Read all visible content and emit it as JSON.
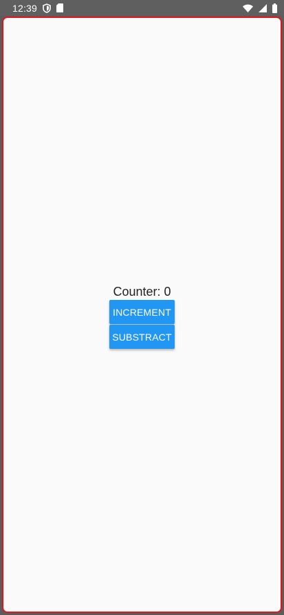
{
  "status_bar": {
    "time": "12:39",
    "left_icons": [
      "shield-icon",
      "sd-card-icon"
    ],
    "right_icons": [
      "wifi-icon",
      "signal-icon",
      "battery-icon"
    ]
  },
  "app": {
    "counter_label": "Counter: 0",
    "increment_label": "INCREMENT",
    "subtract_label": "SUBSTRACT"
  },
  "colors": {
    "button_background": "#2196F3",
    "border_highlight": "#E5141A",
    "screen_background": "#FAFAFA",
    "status_bar_background": "#5F5F5F"
  }
}
